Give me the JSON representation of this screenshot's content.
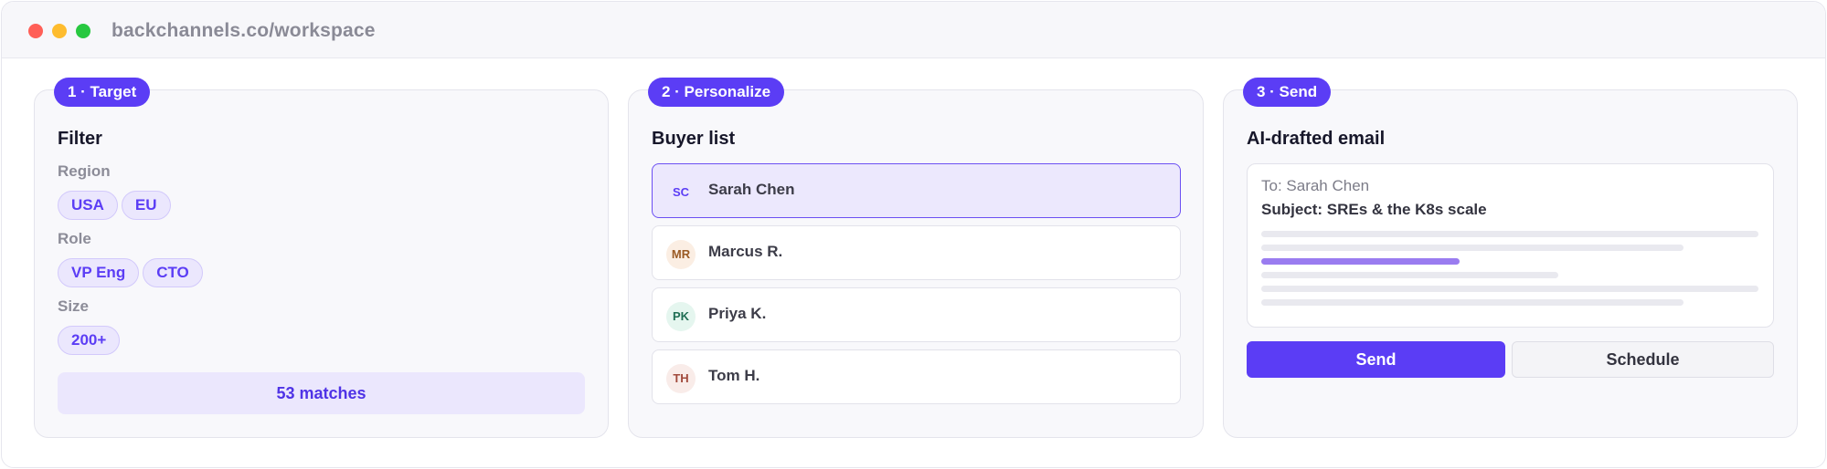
{
  "window": {
    "url": "backchannels.co/workspace"
  },
  "target": {
    "badge": "1 · Target",
    "title": "Filter",
    "region": {
      "label": "Region",
      "options": [
        "USA",
        "EU"
      ]
    },
    "role": {
      "label": "Role",
      "options": [
        "VP Eng",
        "CTO"
      ]
    },
    "size": {
      "label": "Size",
      "options": [
        "200+"
      ]
    },
    "matches": "53 matches"
  },
  "personalize": {
    "badge": "2 · Personalize",
    "title": "Buyer list",
    "buyers": [
      {
        "initials": "SC",
        "name": "Sarah Chen",
        "selected": true,
        "avatar_bg": "#ece8fd",
        "avatar_fg": "#5b3df5"
      },
      {
        "initials": "MR",
        "name": "Marcus R.",
        "selected": false,
        "avatar_bg": "#fbeee3",
        "avatar_fg": "#9a5a24"
      },
      {
        "initials": "PK",
        "name": "Priya K.",
        "selected": false,
        "avatar_bg": "#e5f6ef",
        "avatar_fg": "#1f6e54"
      },
      {
        "initials": "TH",
        "name": "Tom H.",
        "selected": false,
        "avatar_bg": "#f9ece9",
        "avatar_fg": "#a14a3c"
      }
    ]
  },
  "send": {
    "badge": "3 · Send",
    "title": "AI-drafted email",
    "to": "To: Sarah Chen",
    "subject": "Subject: SREs & the K8s scale",
    "send_label": "Send",
    "schedule_label": "Schedule"
  },
  "colors": {
    "accent": "#5b3df5",
    "accent_soft": "#ebe7fd"
  }
}
